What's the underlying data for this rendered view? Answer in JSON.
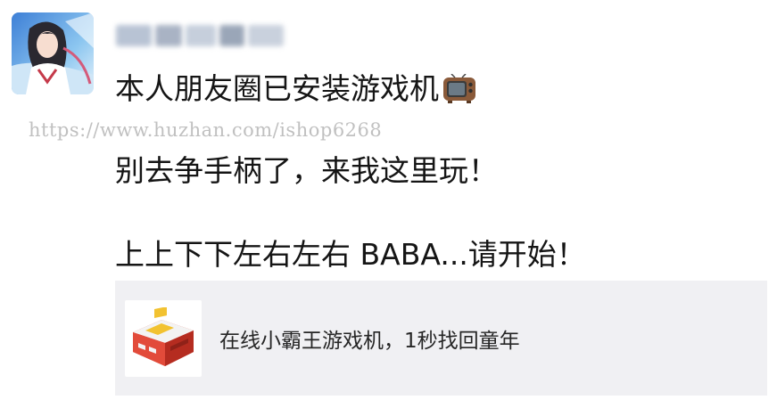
{
  "post": {
    "username_masked": "",
    "line1": "本人朋友圈已安装游戏机",
    "line1_emoji": "tv-icon",
    "line2": "别去争手柄了，来我这里玩！",
    "line3": "上上下下左右左右 BABA...请开始！"
  },
  "watermark": "https://www.huzhan.com/ishop6268",
  "link_card": {
    "title": "在线小霸王游戏机，1秒找回童年",
    "thumbnail_icon": "famicom-console-icon"
  },
  "colors": {
    "card_background": "#f0f0f3",
    "text": "#151515",
    "console_red": "#d93a2b",
    "console_yellow": "#f2c230"
  }
}
